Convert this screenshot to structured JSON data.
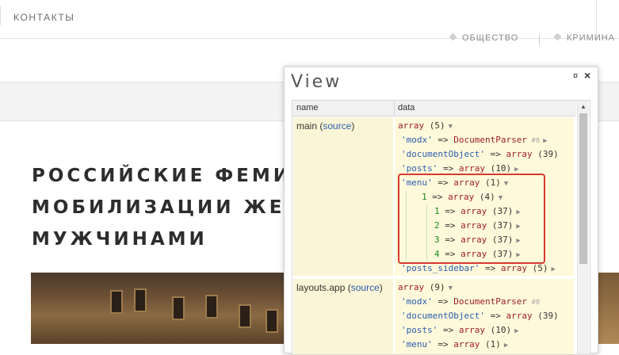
{
  "site": {
    "nav_link": "КОНТАКТЫ",
    "tags": [
      "ОБЩЕСТВО",
      "КРИМИНА"
    ],
    "headline": [
      "РОССИЙСКИЕ ФЕМИ",
      "МОБИЛИЗАЦИИ ЖЕН",
      "МУЖЧИНАМИ"
    ]
  },
  "panel": {
    "title": "View",
    "pin_symbol": "¤",
    "close_symbol": "×",
    "columns": {
      "name": "name",
      "data": "data"
    },
    "rows": [
      {
        "name": "main",
        "source": "source",
        "summary": {
          "type": "array",
          "count": "(5)"
        },
        "entries": [
          {
            "key": "'modx'",
            "type": "DocumentParser",
            "hash": "#8"
          },
          {
            "key": "'documentObject'",
            "type": "array",
            "count": "(39)"
          },
          {
            "key": "'posts'",
            "type": "array",
            "count": "(10)"
          },
          {
            "key": "'menu'",
            "type": "array",
            "count": "(1)"
          },
          {
            "key": "1",
            "type": "array",
            "count": "(4)"
          },
          {
            "key": "1",
            "type": "array",
            "count": "(37)"
          },
          {
            "key": "2",
            "type": "array",
            "count": "(37)"
          },
          {
            "key": "3",
            "type": "array",
            "count": "(37)"
          },
          {
            "key": "4",
            "type": "array",
            "count": "(37)"
          },
          {
            "key": "'posts_sidebar'",
            "type": "array",
            "count": "(5)"
          }
        ]
      },
      {
        "name": "layouts.app",
        "source": "source",
        "summary": {
          "type": "array",
          "count": "(9)"
        },
        "entries": [
          {
            "key": "'modx'",
            "type": "DocumentParser",
            "hash": "#8"
          },
          {
            "key": "'documentObject'",
            "type": "array",
            "count": "(39)"
          },
          {
            "key": "'posts'",
            "type": "array",
            "count": "(10)"
          },
          {
            "key": "'menu'",
            "type": "array",
            "count": "(1)"
          }
        ]
      }
    ],
    "arrow_symbols": {
      "expanded": "▼",
      "collapsed": "▶"
    },
    "operator": "=>"
  },
  "colors": {
    "highlight": "#d9392e",
    "key_string": "#2a5db0",
    "type": "#9e1e2a",
    "numeric_key": "#1c8a1c"
  }
}
